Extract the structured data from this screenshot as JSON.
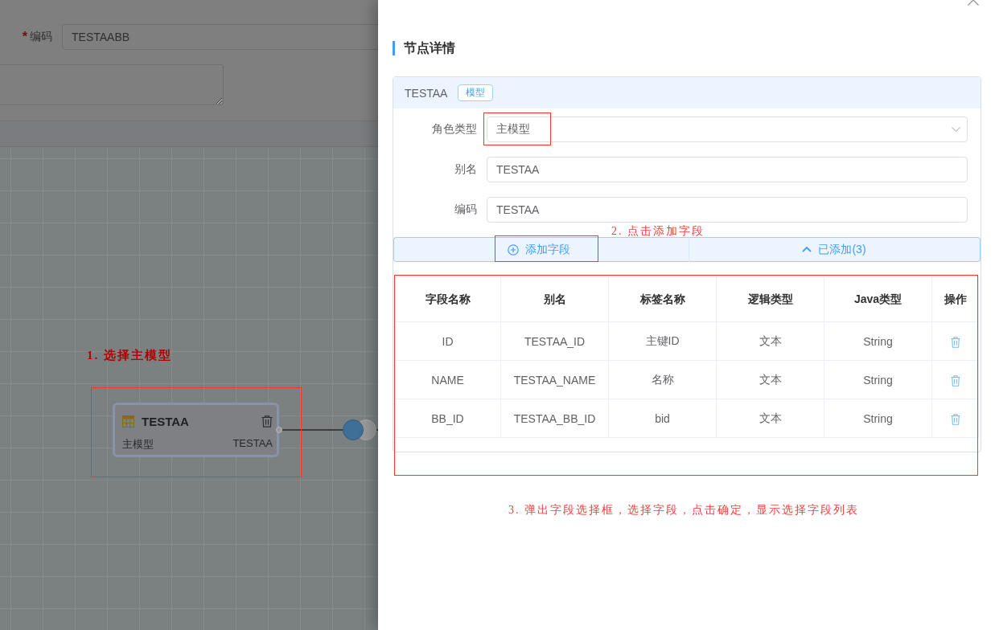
{
  "background_form": {
    "code_field": {
      "required_mark": "*",
      "label": "编码",
      "value": "TESTAABB"
    }
  },
  "canvas": {
    "nodes": [
      {
        "title": "TESTAA",
        "role": "主模型",
        "code": "TESTAA"
      }
    ]
  },
  "drawer": {
    "section_title": "节点详情",
    "card": {
      "name": "TESTAA",
      "tag": "模型",
      "fields": [
        {
          "kind": "select",
          "label": "角色类型",
          "value": "主模型"
        },
        {
          "kind": "input",
          "label": "别名",
          "value": "TESTAA"
        },
        {
          "kind": "input",
          "label": "编码",
          "value": "TESTAA"
        }
      ],
      "add_button": "添加字段",
      "toggle": {
        "label": "已添加(3)",
        "expanded": true
      },
      "table": {
        "columns": [
          "字段名称",
          "别名",
          "标签名称",
          "逻辑类型",
          "Java类型",
          "操作"
        ],
        "rows": [
          {
            "cells": [
              "ID",
              "TESTAA_ID",
              "主键ID",
              "文本",
              "String"
            ]
          },
          {
            "cells": [
              "NAME",
              "TESTAA_NAME",
              "名称",
              "文本",
              "String"
            ]
          },
          {
            "cells": [
              "BB_ID",
              "TESTAA_BB_ID",
              "bid",
              "文本",
              "String"
            ]
          }
        ]
      }
    }
  },
  "annotations": [
    {
      "text": "1. 选择主模型"
    },
    {
      "text": "2. 点击添加字段"
    },
    {
      "text": "3. 弹出字段选择框，选择字段，点击确定，显示选择字段列表"
    }
  ]
}
